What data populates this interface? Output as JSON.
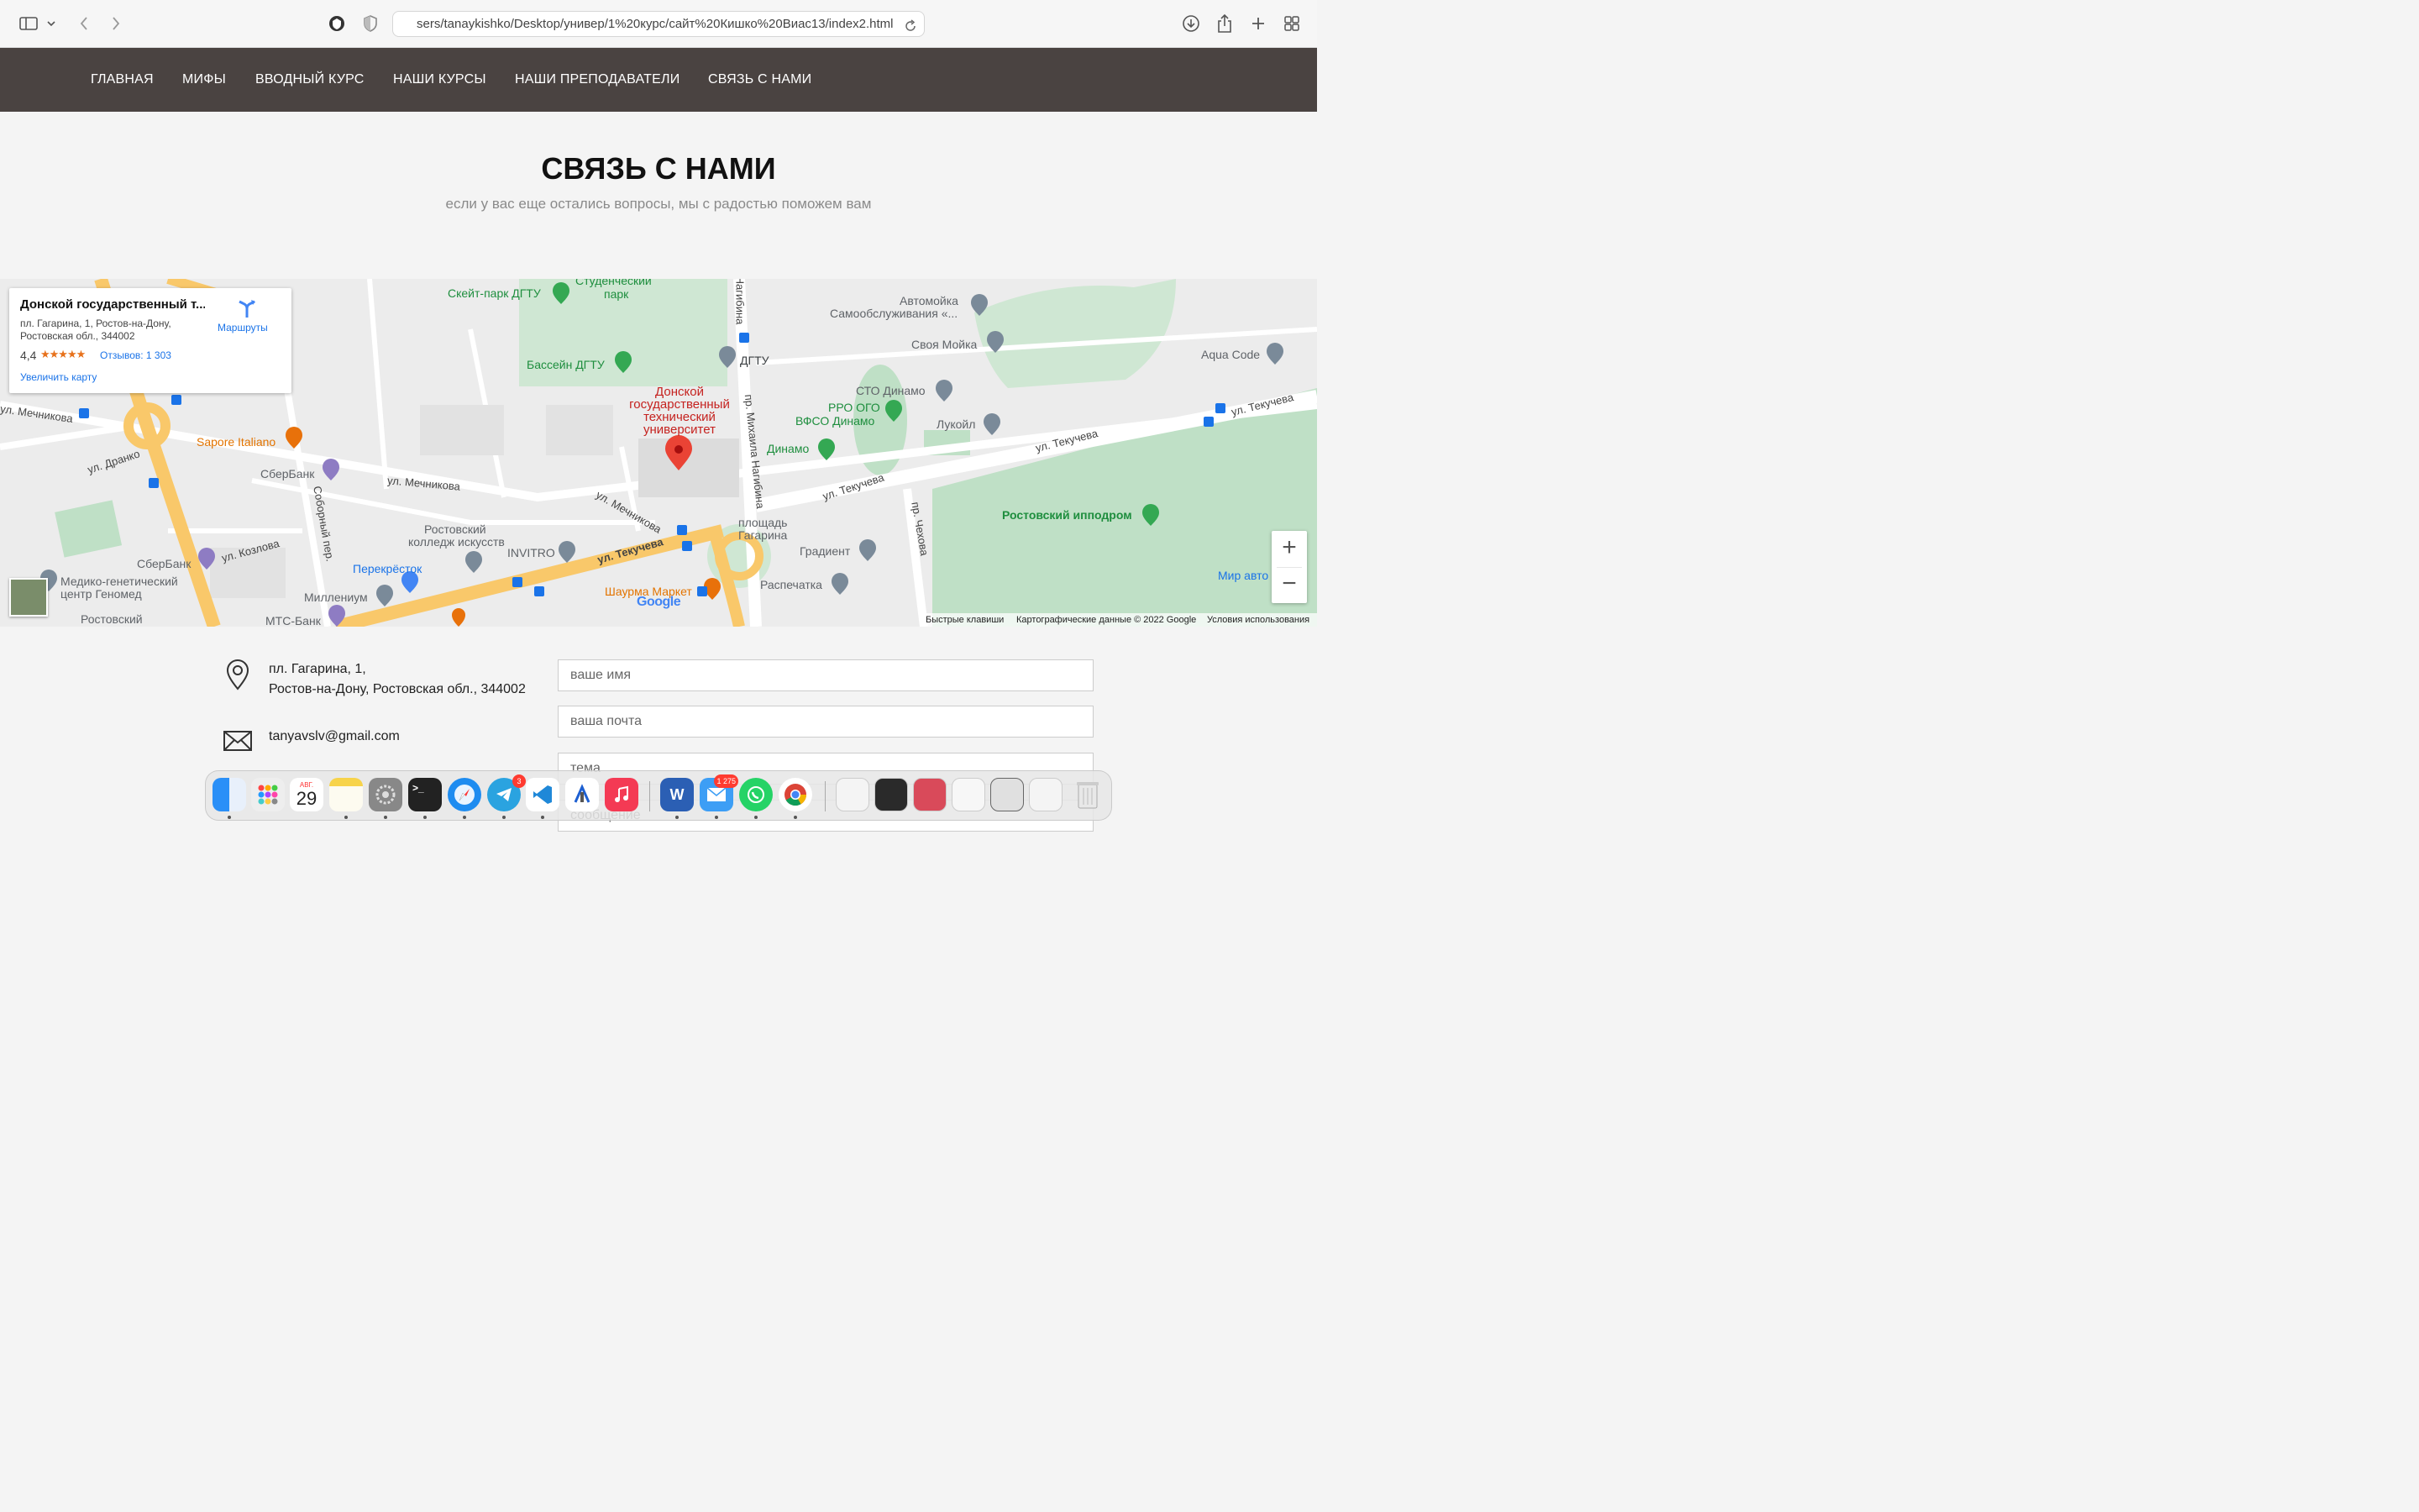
{
  "browser": {
    "url": "sers/tanaykishko/Desktop/универ/1%20курс/сайт%20Кишко%20Виас13/index2.html"
  },
  "nav": {
    "items": [
      "ГЛАВНАЯ",
      "МИФЫ",
      "ВВОДНЫЙ КУРС",
      "НАШИ КУРСЫ",
      "НАШИ ПРЕПОДАВАТЕЛИ",
      "СВЯЗЬ С НАМИ"
    ]
  },
  "header": {
    "title": "СВЯЗЬ С НАМИ",
    "subtitle": "если у вас еще остались вопросы, мы с радостью поможем вам"
  },
  "map": {
    "card": {
      "title": "Донской государственный т...",
      "address_line1": "пл. Гагарина, 1, Ростов-на-Дону,",
      "address_line2": "Ростовская обл., 344002",
      "rating": "4,4",
      "stars": "★★★★★",
      "reviews": "Отзывов: 1 303",
      "enlarge": "Увеличить карту",
      "routes": "Маршруты"
    },
    "labels": {
      "skatepark": "Скейт-парк ДГТУ",
      "student_park_1": "Студенческий",
      "student_park_2": "парк",
      "pool": "Бассейн ДГТУ",
      "dgtu": "ДГТУ",
      "univ_1": "Донской",
      "univ_2": "государственный",
      "univ_3": "технический",
      "univ_4": "университет",
      "carwash_1": "Автомойка",
      "carwash_2": "Самообслуживания «...",
      "svoya_moyka": "Своя Мойка",
      "aqua_code": "Aqua Code",
      "sto_dinamo": "СТО Динамо",
      "rro_ogo": "РРО ОГО",
      "vfso_dinamo": "ВФСО Динамо",
      "lukoil": "Лукойл",
      "dinamo": "Динамо",
      "sapore": "Sapore Italiano",
      "sberbank_1": "СберБанк",
      "sberbank_2": "СберБанк",
      "college_1": "Ростовский",
      "college_2": "колледж искусств",
      "invitro": "INVITRO",
      "perekrestok": "Перекрёсток",
      "millenium": "Миллениум",
      "mts": "МТС-Банк",
      "genomed_1": "Медико-генетический",
      "genomed_2": "центр Геномед",
      "rostovsky": "Ростовский",
      "ploshad_1": "площадь",
      "ploshad_2": "Гагарина",
      "gradient": "Градиент",
      "raspechatka": "Распечатка",
      "shaurma": "Шаурма Маркет",
      "hippodrome": "Ростовский ипподром",
      "mir_avto": "Мир авто",
      "st_mechnikova_1": "ул. Мечникова",
      "st_mechnikova_2": "ул. Мечникова",
      "st_mechnikova_3": "ул. Мечникова",
      "st_dranko": "ул. Дранко",
      "st_kozlova": "ул. Козлова",
      "st_sobornyi": "Соборный пер.",
      "st_tekucheva_1": "ул. Текучева",
      "st_tekucheva_2": "ул. Текучева",
      "st_tekucheva_3": "ул. Текучева",
      "st_tekucheva_4": "ул. Текучева",
      "st_nagibina_1": "пр. Михаила Нагибина",
      "st_nagibina_2": "Нагибина",
      "st_chekhova": "пр. Чехова"
    },
    "footer": {
      "shortcuts": "Быстрые клавиши",
      "mapdata": "Картографические данные © 2022 Google",
      "terms": "Условия использования"
    },
    "google": "Google",
    "zoom_in": "+",
    "zoom_out": "−"
  },
  "contact": {
    "address_line1": "пл. Гагарина, 1,",
    "address_line2": "Ростов-на-Дону, Ростовская обл., 344002",
    "email": "tanyavslv@gmail.com"
  },
  "form": {
    "name_placeholder": "ваше имя",
    "email_placeholder": "ваша почта",
    "subject_placeholder": "тема",
    "message_placeholder": "сообщение"
  },
  "dock": {
    "calendar_month": "АВГ.",
    "calendar_day": "29",
    "telegram_badge": "3",
    "mail_badge": "1 275"
  }
}
